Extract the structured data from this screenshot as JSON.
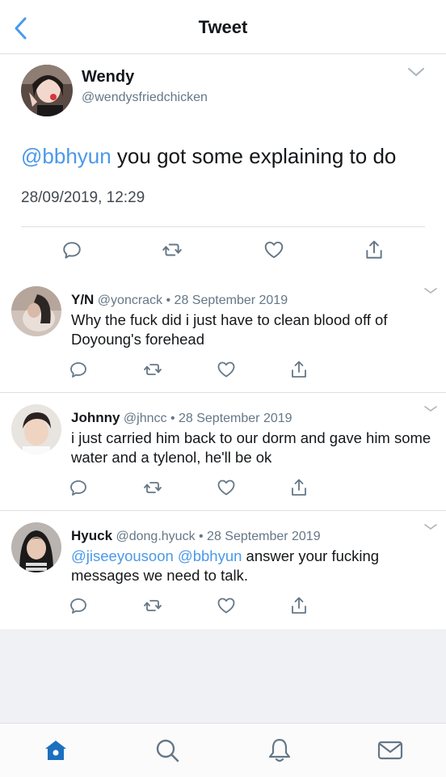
{
  "header": {
    "title": "Tweet"
  },
  "main_tweet": {
    "name": "Wendy",
    "handle": "@wendysfriedchicken",
    "mention": "@bbhyun",
    "text": " you got some explaining to do",
    "timestamp": "28/09/2019, 12:29"
  },
  "replies": [
    {
      "name": "Y/N",
      "handle": "@yoncrack",
      "date": " • 28 September 2019",
      "mentions": [],
      "text": "Why the fuck did i just have to clean blood off of Doyoung's forehead"
    },
    {
      "name": "Johnny",
      "handle": "@jhncc",
      "date": " • 28 September 2019",
      "mentions": [],
      "text": "i just carried him back to our dorm and gave him some water and a tylenol, he'll be ok"
    },
    {
      "name": "Hyuck",
      "handle": "@dong.hyuck",
      "date": " • 28 September 2019",
      "mentions": [
        "@jiseeyousoon",
        "@bbhyun"
      ],
      "text": " answer your fucking messages we need to talk."
    }
  ],
  "icons": {
    "back": "chevron-left-icon",
    "caret": "chevron-down-icon",
    "actions": [
      "reply-icon",
      "retweet-icon",
      "like-icon",
      "share-icon"
    ],
    "tabs": [
      "home-icon",
      "search-icon",
      "notifications-icon",
      "messages-icon"
    ]
  },
  "colors": {
    "accent": "#4a99e9",
    "text": "#14171a",
    "secondary": "#657786",
    "tab_active": "#1c6fbf"
  }
}
